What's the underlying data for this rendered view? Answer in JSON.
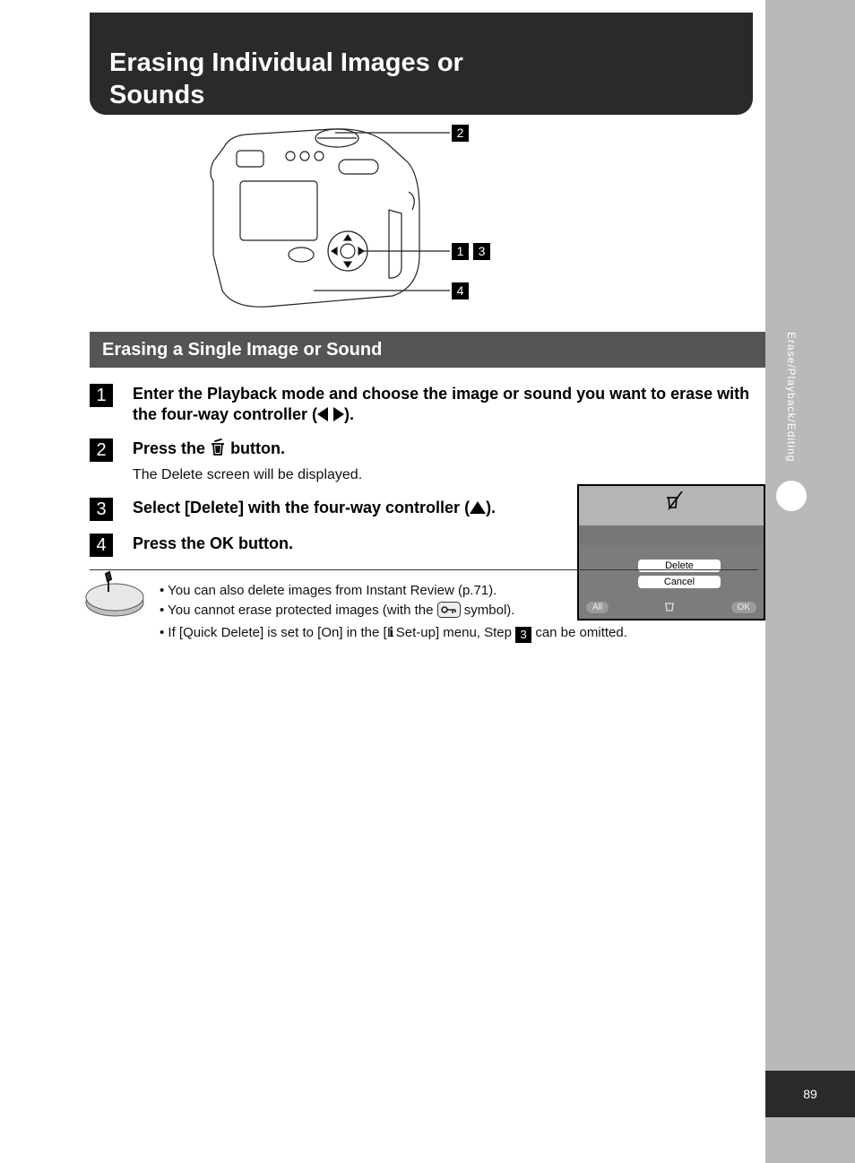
{
  "page_number": "89",
  "sidebar_label": "Erase/Playback/Editing",
  "title_line1": "Erasing Individual Images or",
  "title_line2": "Sounds",
  "callouts": {
    "a": "1",
    "b": "2",
    "c": "3",
    "d": "4"
  },
  "section_heading": "Erasing a Single Image or Sound",
  "steps": {
    "s1": {
      "num": "1",
      "heading_pre": "Enter the Playback mode and choose the image or sound you want to erase with the four-way controller (",
      "heading_post": ")."
    },
    "s2": {
      "num": "2",
      "heading_pre": "Press the ",
      "heading_post": " button.",
      "body": "The Delete screen will be displayed."
    },
    "s3": {
      "num": "3",
      "heading_pre": "Select [Delete] with the four-way controller (",
      "heading_post": ")."
    },
    "s4": {
      "num": "4",
      "heading": "Press the OK button."
    }
  },
  "lcd": {
    "option_delete": "Delete",
    "option_cancel": "Cancel",
    "bottom_left": "All",
    "bottom_right": "OK"
  },
  "memo": {
    "bullet1_a": "You can also delete images from Instant Review (p.71).",
    "bullet2_a": "You cannot erase protected images (with the ",
    "bullet2_b": " symbol).",
    "bullet3_a": "If [Quick Delete] is set to [On] in the [",
    "bullet3_b": " Set-up] menu, Step ",
    "bullet3_c": " can be omitted."
  }
}
